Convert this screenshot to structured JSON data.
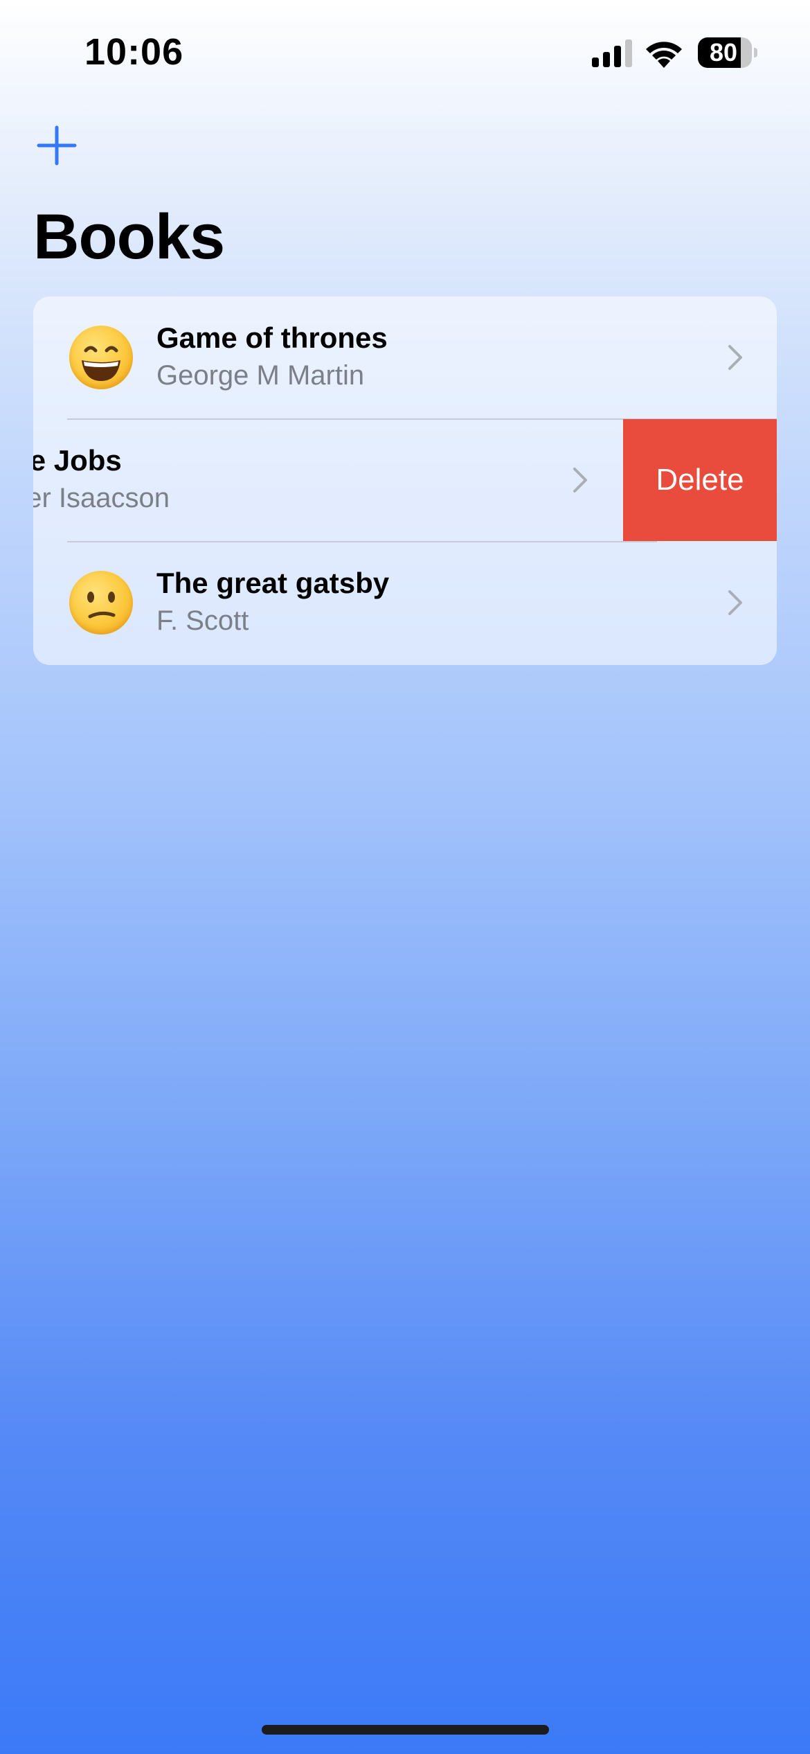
{
  "status_bar": {
    "time": "10:06",
    "battery_level": "80",
    "signal_bars": 3,
    "icons": [
      "signal-icon",
      "wifi-icon",
      "battery-icon"
    ]
  },
  "nav": {
    "add_icon": "plus-icon",
    "title": "Books"
  },
  "books": [
    {
      "title": "Game of thrones",
      "author": "George M Martin",
      "emoji": "grinning-face",
      "swiped": false
    },
    {
      "title": "eve Jobs",
      "author": "alter Isaacson",
      "emoji": "",
      "swiped": true
    },
    {
      "title": "The great gatsby",
      "author": "F. Scott",
      "emoji": "confused-face",
      "swiped": false
    }
  ],
  "swipe_action": {
    "label": "Delete",
    "color": "#e94c3d"
  },
  "colors": {
    "accent": "#3478f6",
    "background_top": "#ffffff",
    "background_bottom": "#3b7af7"
  }
}
